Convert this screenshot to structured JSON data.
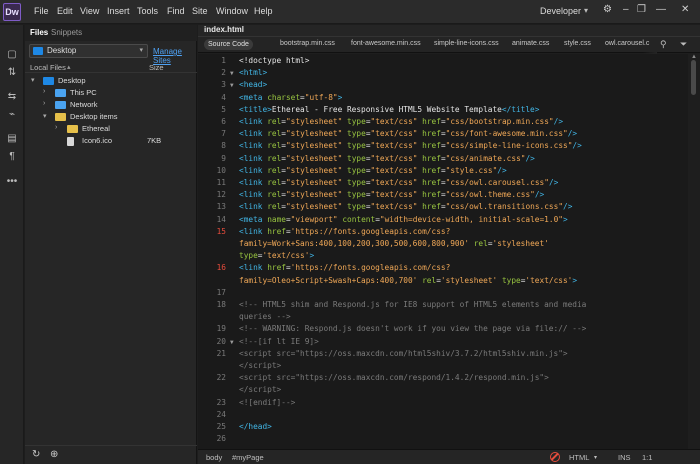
{
  "app": {
    "logo": "Dw",
    "menus": [
      "File",
      "Edit",
      "View",
      "Insert",
      "Tools",
      "Find",
      "Site",
      "Window",
      "Help"
    ],
    "workspace": "Developer"
  },
  "files_panel": {
    "tabs": [
      "Files",
      "Snippets"
    ],
    "site_select": "Desktop",
    "manage_sites": "Manage Sites",
    "header_local": "Local Files",
    "header_size": "Size",
    "tree": [
      {
        "name": "Desktop",
        "size": "",
        "level": 0,
        "kind": "desktop",
        "arrow": "▾"
      },
      {
        "name": "This PC",
        "size": "",
        "level": 1,
        "kind": "pc",
        "arrow": "›"
      },
      {
        "name": "Network",
        "size": "",
        "level": 1,
        "kind": "network",
        "arrow": "›"
      },
      {
        "name": "Desktop items",
        "size": "",
        "level": 1,
        "kind": "folder",
        "arrow": "▾"
      },
      {
        "name": "Ethereal",
        "size": "",
        "level": 2,
        "kind": "folder",
        "arrow": "›"
      },
      {
        "name": "Icon6.ico",
        "size": "7KB",
        "level": 2,
        "kind": "file",
        "arrow": ""
      }
    ]
  },
  "editor": {
    "document": "index.html",
    "source_code": "Source Code",
    "related_files": [
      "bootstrap.min.css",
      "font-awesome.min.css",
      "simple-line-icons.css",
      "animate.css",
      "style.css",
      "owl.carousel.c"
    ],
    "lines": [
      {
        "n": "1",
        "html": "&lt;!doctype html&gt;"
      },
      {
        "n": "2",
        "html": "<span class='tag'>&lt;html&gt;</span>",
        "fold": true
      },
      {
        "n": "3",
        "html": "<span class='tag'>&lt;head&gt;</span>",
        "fold": true
      },
      {
        "n": "4",
        "html": "<span class='tag'>&lt;meta</span> <span class='attr'>charset</span>=<span class='str'>\"utf-8\"</span><span class='tag'>&gt;</span>"
      },
      {
        "n": "5",
        "html": "<span class='tag'>&lt;title&gt;</span>Ethereal - Free Responsive HTML5 Website Template<span class='tag'>&lt;/title&gt;</span>"
      },
      {
        "n": "6",
        "html": "<span class='tag'>&lt;link</span> <span class='attr'>rel</span>=<span class='str'>\"stylesheet\"</span> <span class='attr'>type</span>=<span class='str'>\"text/css\"</span> <span class='attr'>href</span>=<span class='str'>\"css/bootstrap.min.css\"</span><span class='tag'>/&gt;</span>"
      },
      {
        "n": "7",
        "html": "<span class='tag'>&lt;link</span> <span class='attr'>rel</span>=<span class='str'>\"stylesheet\"</span> <span class='attr'>type</span>=<span class='str'>\"text/css\"</span> <span class='attr'>href</span>=<span class='str'>\"css/font-awesome.min.css\"</span><span class='tag'>/&gt;</span>"
      },
      {
        "n": "8",
        "html": "<span class='tag'>&lt;link</span> <span class='attr'>rel</span>=<span class='str'>\"stylesheet\"</span> <span class='attr'>type</span>=<span class='str'>\"text/css\"</span> <span class='attr'>href</span>=<span class='str'>\"css/simple-line-icons.css\"</span><span class='tag'>/&gt;</span>"
      },
      {
        "n": "9",
        "html": "<span class='tag'>&lt;link</span> <span class='attr'>rel</span>=<span class='str'>\"stylesheet\"</span> <span class='attr'>type</span>=<span class='str'>\"text/css\"</span> <span class='attr'>href</span>=<span class='str'>\"css/animate.css\"</span><span class='tag'>/&gt;</span>"
      },
      {
        "n": "10",
        "html": "<span class='tag'>&lt;link</span> <span class='attr'>rel</span>=<span class='str'>\"stylesheet\"</span> <span class='attr'>type</span>=<span class='str'>\"text/css\"</span> <span class='attr'>href</span>=<span class='str'>\"style.css\"</span><span class='tag'>/&gt;</span>"
      },
      {
        "n": "11",
        "html": "<span class='tag'>&lt;link</span> <span class='attr'>rel</span>=<span class='str'>\"stylesheet\"</span> <span class='attr'>type</span>=<span class='str'>\"text/css\"</span> <span class='attr'>href</span>=<span class='str'>\"css/owl.carousel.css\"</span><span class='tag'>/&gt;</span>"
      },
      {
        "n": "12",
        "html": "<span class='tag'>&lt;link</span> <span class='attr'>rel</span>=<span class='str'>\"stylesheet\"</span> <span class='attr'>type</span>=<span class='str'>\"text/css\"</span> <span class='attr'>href</span>=<span class='str'>\"css/owl.theme.css\"</span><span class='tag'>/&gt;</span>"
      },
      {
        "n": "13",
        "html": "<span class='tag'>&lt;link</span> <span class='attr'>rel</span>=<span class='str'>\"stylesheet\"</span> <span class='attr'>type</span>=<span class='str'>\"text/css\"</span> <span class='attr'>href</span>=<span class='str'>\"css/owl.transitions.css\"</span><span class='tag'>/&gt;</span>"
      },
      {
        "n": "14",
        "html": "<span class='tag'>&lt;meta</span> <span class='attr'>name</span>=<span class='str'>\"viewport\"</span> <span class='attr'>content</span>=<span class='str'>\"width=device-width, initial-scale=1.0\"</span><span class='tag'>&gt;</span>"
      },
      {
        "n": "15",
        "err": true,
        "html": "<span class='tag'>&lt;link</span> <span class='attr'>href</span>=<span class='str'>'https://fonts.googleapis.com/css?</span>"
      },
      {
        "n": "",
        "html": "<span class='str'>family=Work+Sans:400,100,200,300,500,600,800,900'</span> <span class='attr'>rel</span>=<span class='str'>'stylesheet'</span>"
      },
      {
        "n": "",
        "html": "<span class='attr'>type</span>=<span class='str'>'text/css'</span><span class='tag'>&gt;</span>"
      },
      {
        "n": "16",
        "err": true,
        "html": "<span class='tag'>&lt;link</span> <span class='attr'>href</span>=<span class='str'>'https://fonts.googleapis.com/css?</span>"
      },
      {
        "n": "",
        "html": "<span class='str'>family=Oleo+Script+Swash+Caps:400,700'</span> <span class='attr'>rel</span>=<span class='str'>'stylesheet'</span> <span class='attr'>type</span>=<span class='str'>'text/css'</span><span class='tag'>&gt;</span>"
      },
      {
        "n": "17",
        "html": ""
      },
      {
        "n": "18",
        "html": "<span class='cmt'>&lt;!-- HTML5 shim and Respond.js for IE8 support of HTML5 elements and media</span>"
      },
      {
        "n": "",
        "html": "<span class='cmt'>queries --&gt;</span>"
      },
      {
        "n": "19",
        "html": "<span class='cmt'>&lt;!-- WARNING: Respond.js doesn't work if you view the page via file:// --&gt;</span>"
      },
      {
        "n": "20",
        "html": "<span class='cmt'>&lt;!--[if lt IE 9]&gt;</span>",
        "fold": true
      },
      {
        "n": "21",
        "html": "<span class='cmt'>      &lt;script src=\"https://oss.maxcdn.com/html5shiv/3.7.2/html5shiv.min.js\"&gt;</span>"
      },
      {
        "n": "",
        "html": "<span class='cmt'>      &lt;/script&gt;</span>"
      },
      {
        "n": "22",
        "html": "<span class='cmt'>      &lt;script src=\"https://oss.maxcdn.com/respond/1.4.2/respond.min.js\"&gt;</span>"
      },
      {
        "n": "",
        "html": "<span class='cmt'>      &lt;/script&gt;</span>"
      },
      {
        "n": "23",
        "html": "<span class='cmt'>    &lt;![endif]--&gt;</span>"
      },
      {
        "n": "24",
        "html": ""
      },
      {
        "n": "25",
        "html": "<span class='tag'>&lt;/head&gt;</span>"
      },
      {
        "n": "26",
        "html": ""
      }
    ]
  },
  "status": {
    "tag1": "body",
    "tag2": "#myPage",
    "mode": "HTML",
    "ins": "INS",
    "pos": "1:1"
  },
  "colors": {
    "accent": "#4ea1f3",
    "error": "#e74c3c",
    "tag": "#42b7e7",
    "attr": "#98c440",
    "string": "#f0a857"
  }
}
